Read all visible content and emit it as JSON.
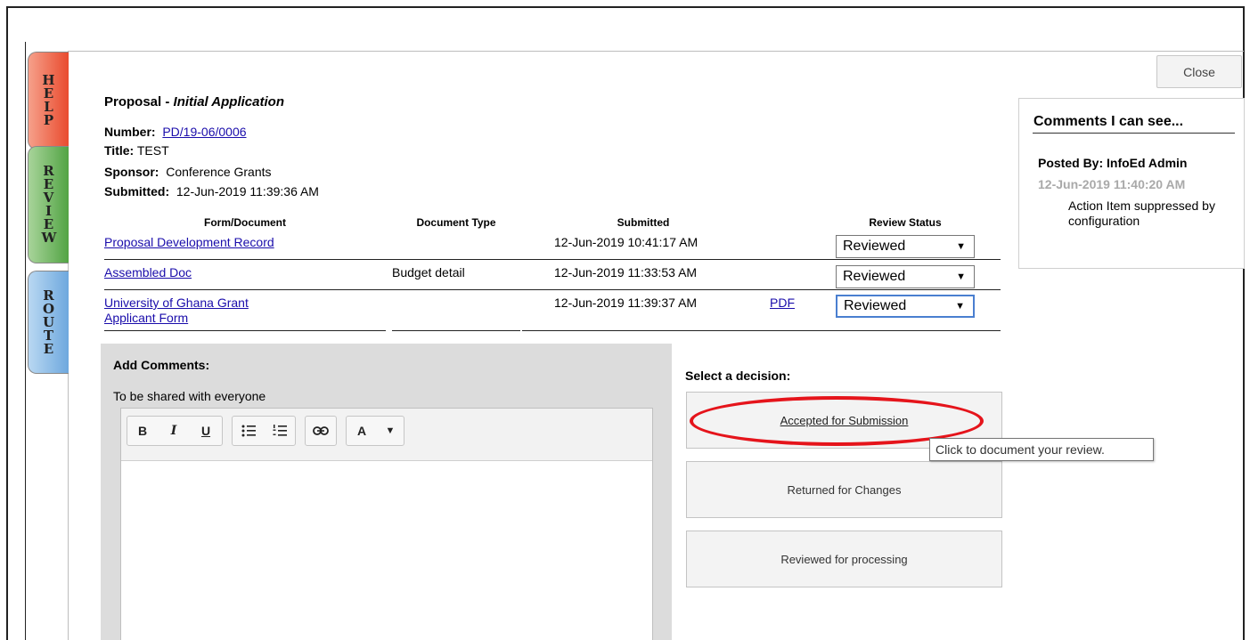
{
  "close_label": "Close",
  "side_tabs": {
    "help": "HELP",
    "review": "REVIEW",
    "route": "ROUTE"
  },
  "proposal": {
    "type": "Proposal",
    "stage": "Initial Application",
    "number_label": "Number:",
    "number": "PD/19-06/0006",
    "title_label": "Title:",
    "title": "TEST",
    "sponsor_label": "Sponsor:",
    "sponsor": "Conference Grants",
    "submitted_label": "Submitted:",
    "submitted": "12-Jun-2019 11:39:36 AM"
  },
  "documents": {
    "headers": {
      "form": "Form/Document",
      "type": "Document Type",
      "submitted": "Submitted",
      "status": "Review Status"
    },
    "rows": [
      {
        "form": "Proposal Development Record",
        "type": "",
        "submitted": "12-Jun-2019 10:41:17 AM",
        "pdf": "",
        "status": "Reviewed"
      },
      {
        "form": "Assembled Doc",
        "type": "Budget detail",
        "submitted": "12-Jun-2019 11:33:53 AM",
        "pdf": "",
        "status": "Reviewed"
      },
      {
        "form_line1": "University of Ghana Grant",
        "form_line2": "Applicant Form",
        "type": "",
        "submitted": "12-Jun-2019 11:39:37 AM",
        "pdf": "PDF",
        "status": "Reviewed"
      }
    ]
  },
  "comments_pane": {
    "title": "Comments I can see...",
    "posted_by": "Posted By: InfoEd Admin",
    "posted_date": "12-Jun-2019 11:40:20 AM",
    "text": "Action Item suppressed by configuration"
  },
  "add_comments": {
    "title": "Add Comments:",
    "share_label": "To be shared with everyone",
    "toolbar": {
      "bold": "B",
      "italic": "I",
      "underline": "U",
      "font_color": "A",
      "dropdown": "▼"
    }
  },
  "decisions": {
    "label": "Select a decision:",
    "options": [
      "Accepted for Submission",
      "Returned for Changes",
      "Reviewed for processing"
    ],
    "tooltip": "Click to document your review."
  },
  "colors": {
    "help_tab": "#e94b2f",
    "review_tab": "#52a444",
    "route_tab": "#6ea8de",
    "highlight": "#e5141b",
    "link": "#1a0dab"
  }
}
